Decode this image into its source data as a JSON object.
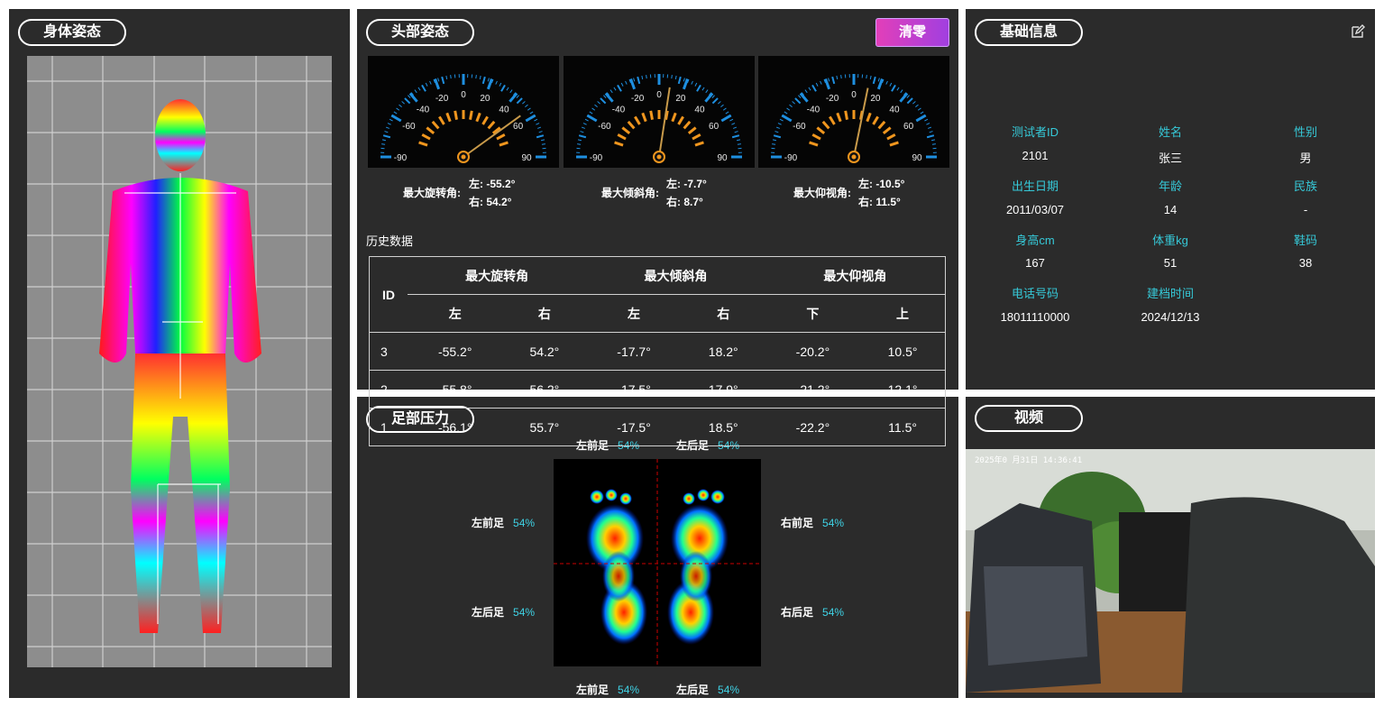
{
  "body_panel": {
    "title": "身体姿态"
  },
  "head_panel": {
    "title": "头部姿态",
    "clear_label": "清零",
    "gauges": [
      {
        "caption": "最大旋转角:",
        "left_value": "左:  -55.2°",
        "right_value": "右:  54.2°",
        "reading": 54.2
      },
      {
        "caption": "最大倾斜角:",
        "left_value": "左:  -7.7°",
        "right_value": "右:  8.7°",
        "reading": 8.7
      },
      {
        "caption": "最大仰视角:",
        "left_value": "左:  -10.5°",
        "right_value": "右:  11.5°",
        "reading": 11.5
      }
    ],
    "gauge_scale": [
      "-90",
      "-60",
      "-40",
      "-20",
      "0",
      "20",
      "40",
      "60",
      "90"
    ],
    "history_title": "历史数据",
    "table": {
      "id_header": "ID",
      "group_headers": [
        "最大旋转角",
        "最大倾斜角",
        "最大仰视角"
      ],
      "sub_headers": [
        "左",
        "右",
        "左",
        "右",
        "下",
        "上"
      ],
      "rows": [
        [
          "3",
          "-55.2°",
          "54.2°",
          "-17.7°",
          "18.2°",
          "-20.2°",
          "10.5°"
        ],
        [
          "2",
          "-55.8°",
          "56.2°",
          "-17.5°",
          "17.9°",
          "-21.2°",
          "12.1°"
        ],
        [
          "1",
          "-56.1°",
          "55.7°",
          "-17.5°",
          "18.5°",
          "-22.2°",
          "11.5°"
        ]
      ]
    }
  },
  "foot_panel": {
    "title": "足部压力",
    "labels": {
      "top_left": {
        "name": "左前足",
        "value": "54%"
      },
      "top_right": {
        "name": "左后足",
        "value": "54%"
      },
      "mid_left_top": {
        "name": "左前足",
        "value": "54%"
      },
      "mid_left_bottom": {
        "name": "左后足",
        "value": "54%"
      },
      "mid_right_top": {
        "name": "右前足",
        "value": "54%"
      },
      "mid_right_bottom": {
        "name": "右后足",
        "value": "54%"
      },
      "bottom_left": {
        "name": "左前足",
        "value": "54%"
      },
      "bottom_right": {
        "name": "左后足",
        "value": "54%"
      }
    }
  },
  "info_panel": {
    "title": "基础信息",
    "fields": [
      {
        "key": "测试者ID",
        "value": "2101"
      },
      {
        "key": "姓名",
        "value": "张三"
      },
      {
        "key": "性别",
        "value": "男"
      },
      {
        "key": "出生日期",
        "value": "2011/03/07"
      },
      {
        "key": "年龄",
        "value": "14"
      },
      {
        "key": "民族",
        "value": "-"
      },
      {
        "key": "身高cm",
        "value": "167"
      },
      {
        "key": "体重kg",
        "value": "51"
      },
      {
        "key": "鞋码",
        "value": "38"
      },
      {
        "key": "电话号码",
        "value": "18011110000"
      },
      {
        "key": "建档时间",
        "value": "2024/12/13"
      }
    ]
  },
  "video_panel": {
    "title": "视频",
    "timestamp": "2025年0 月31日 14:36:41"
  },
  "colors": {
    "panel_bg": "#2b2b2b",
    "accent_cyan": "#36c9d8",
    "gauge_blue": "#1e8fe0",
    "gauge_orange": "#f0961e"
  }
}
